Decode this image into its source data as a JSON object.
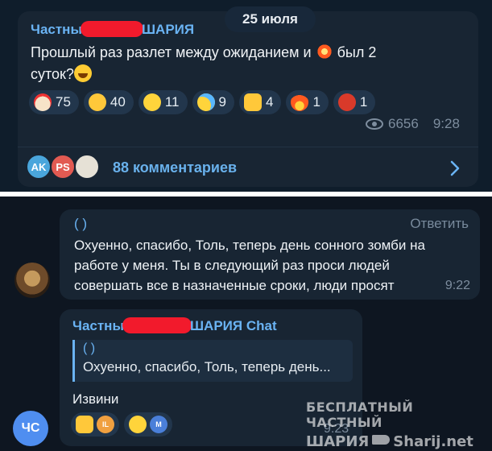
{
  "date_pill": "25 июля",
  "post": {
    "author_left": "Частны",
    "author_right": "ШАРИЯ",
    "text_line1": "Прошлый раз разлет между ожиданием и",
    "text_after_icon": "был 2",
    "text_line2": "суток?",
    "reactions": [
      {
        "icon": "clown-emoji",
        "count": "75"
      },
      {
        "icon": "thinking-emoji",
        "count": "40"
      },
      {
        "icon": "grin-emoji",
        "count": "11"
      },
      {
        "icon": "crying-emoji",
        "count": "9"
      },
      {
        "icon": "thumbs-up-emoji",
        "count": "4"
      },
      {
        "icon": "fire-emoji",
        "count": "1"
      },
      {
        "icon": "angry-emoji",
        "count": "1"
      }
    ],
    "views": "6656",
    "time": "9:28",
    "comments": {
      "avatars": [
        "AK",
        "PS"
      ],
      "label": "88 комментариев"
    }
  },
  "chat": {
    "msg1": {
      "reply_link": "( )",
      "reply_action": "Ответить",
      "text": "Охуенно, спасибо, Толь, теперь день сонного зомби на работе у меня. Ты в следующий раз проси людей совершать все в назначенные сроки, люди просят",
      "time": "9:22"
    },
    "msg2": {
      "author_left": "Частны",
      "author_right": "ШАРИЯ Chat",
      "quote_link": "( )",
      "quote_text": "Охуенно, спасибо, Толь, теперь день...",
      "text": "Извини",
      "react_avatars": [
        "IL",
        "M"
      ],
      "time": "9:23"
    },
    "avatar_initials": "ЧС"
  },
  "watermark": {
    "line1": "БЕСПЛАТНЫЙ ЧАСТНЫЙ",
    "line2_left": "ШАРИЯ",
    "line2_right": "Sharij.net"
  },
  "colors": {
    "bubble": "#182533",
    "link": "#6ab3f3",
    "redaction": "#f21a2c",
    "background": "#0e1621"
  }
}
